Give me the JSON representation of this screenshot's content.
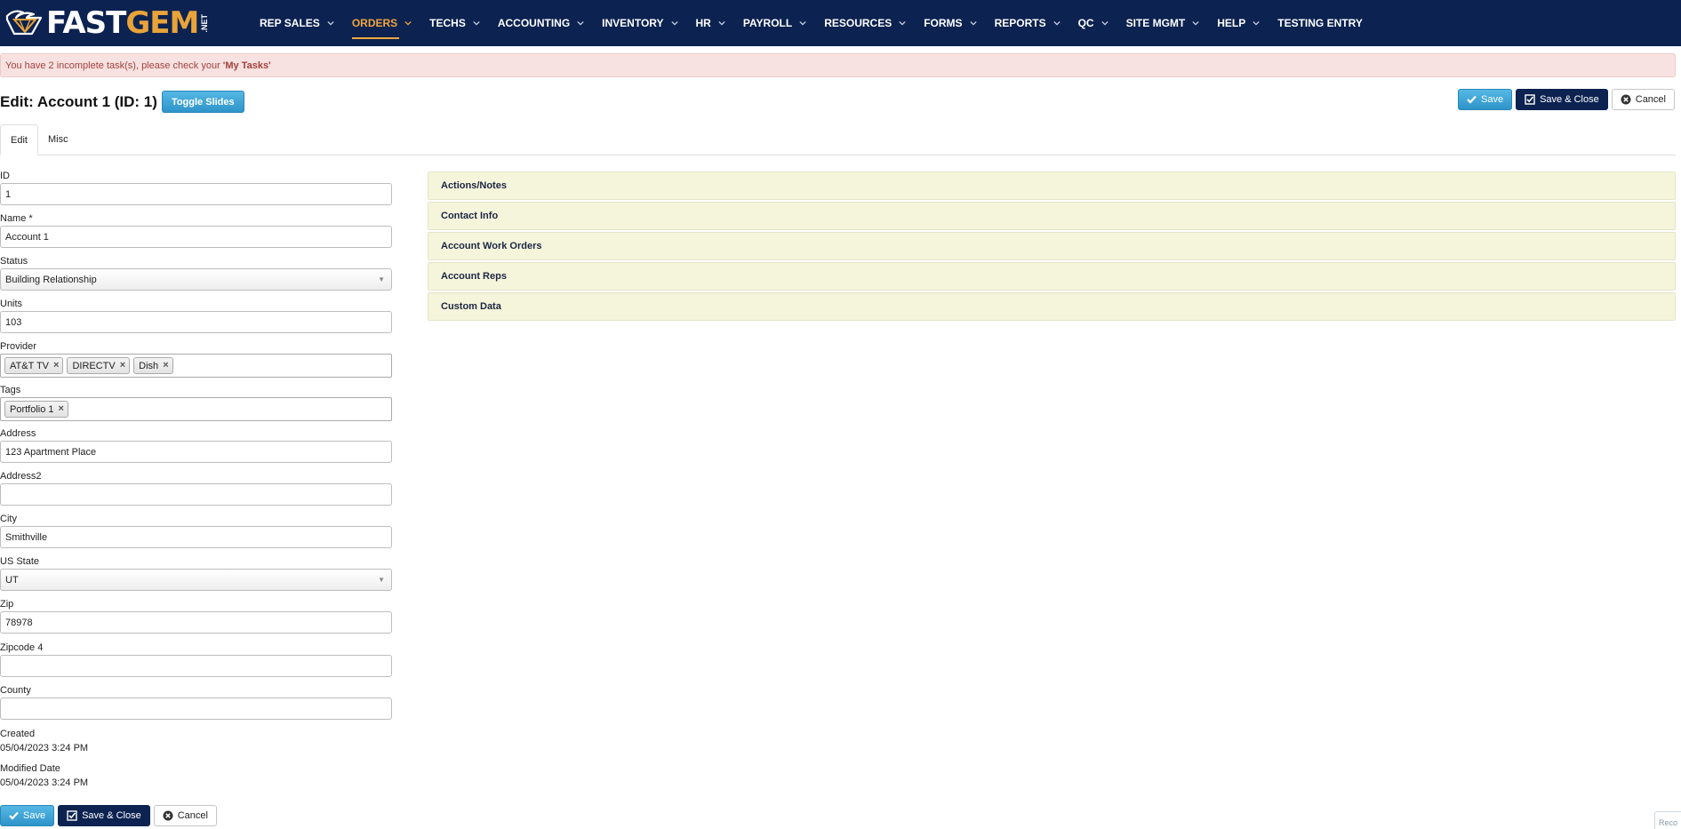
{
  "nav": {
    "logo": {
      "fast": "FAST",
      "gem": "GEM",
      "net": ".NET"
    },
    "items": [
      {
        "label": "REP SALES",
        "chevron": true
      },
      {
        "label": "ORDERS",
        "chevron": true,
        "active": true
      },
      {
        "label": "TECHS",
        "chevron": true
      },
      {
        "label": "ACCOUNTING",
        "chevron": true
      },
      {
        "label": "INVENTORY",
        "chevron": true
      },
      {
        "label": "HR",
        "chevron": true
      },
      {
        "label": "PAYROLL",
        "chevron": true
      },
      {
        "label": "RESOURCES",
        "chevron": true
      },
      {
        "label": "FORMS",
        "chevron": true
      },
      {
        "label": "REPORTS",
        "chevron": true
      },
      {
        "label": "QC",
        "chevron": true
      },
      {
        "label": "SITE MGMT",
        "chevron": true
      },
      {
        "label": "HELP",
        "chevron": true
      },
      {
        "label": "TESTING ENTRY",
        "chevron": false
      }
    ]
  },
  "alert": {
    "text": "You have 2 incomplete task(s), please check your",
    "link": "'My Tasks'"
  },
  "header": {
    "title": "Edit: Account 1 (ID: 1)",
    "toggle_label": "Toggle Slides"
  },
  "actions": {
    "save": "Save",
    "save_close": "Save & Close",
    "cancel": "Cancel"
  },
  "tabs": [
    {
      "label": "Edit",
      "active": true
    },
    {
      "label": "Misc",
      "active": false
    }
  ],
  "form": {
    "id": {
      "label": "ID",
      "value": "1"
    },
    "name": {
      "label": "Name *",
      "value": "Account 1"
    },
    "status": {
      "label": "Status",
      "value": "Building Relationship"
    },
    "units": {
      "label": "Units",
      "value": "103"
    },
    "provider": {
      "label": "Provider",
      "tags": [
        "AT&T TV",
        "DIRECTV",
        "Dish"
      ]
    },
    "tags": {
      "label": "Tags",
      "tags": [
        "Portfolio 1"
      ]
    },
    "address": {
      "label": "Address",
      "value": "123 Apartment Place"
    },
    "address2": {
      "label": "Address2",
      "value": ""
    },
    "city": {
      "label": "City",
      "value": "Smithville"
    },
    "state": {
      "label": "US State",
      "value": "UT"
    },
    "zip": {
      "label": "Zip",
      "value": "78978"
    },
    "zip4": {
      "label": "Zipcode 4",
      "value": ""
    },
    "county": {
      "label": "County",
      "value": ""
    },
    "created": {
      "label": "Created",
      "value": "05/04/2023 3:24 PM"
    },
    "modified": {
      "label": "Modified Date",
      "value": "05/04/2023 3:24 PM"
    }
  },
  "accordion": [
    "Actions/Notes",
    "Contact Info",
    "Account Work Orders",
    "Account Reps",
    "Custom Data"
  ],
  "corner": {
    "text": "Reco"
  },
  "colors": {
    "nav_bg": "#0c2250",
    "accent": "#f0a640",
    "save_blue": "#3fa4d7",
    "alert_bg": "#f8e2e1",
    "panel_bg": "#f5f5dc"
  }
}
